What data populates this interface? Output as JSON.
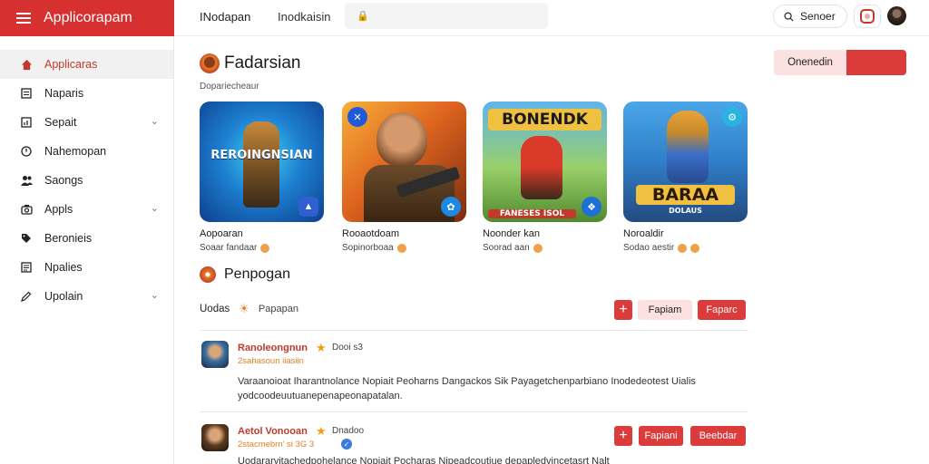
{
  "app": {
    "title": "Applicorapam"
  },
  "header": {
    "title": "INodapan",
    "subtitle": "Inodkaisin",
    "search_placeholder": "",
    "search_button": "Senoer"
  },
  "sidebar": {
    "items": [
      {
        "label": "Applicaras",
        "icon": "home-icon",
        "active": true,
        "chevron": false
      },
      {
        "label": "Naparis",
        "icon": "document-icon",
        "active": false,
        "chevron": false
      },
      {
        "label": "Sepait",
        "icon": "chart-icon",
        "active": false,
        "chevron": true
      },
      {
        "label": "Nahemopan",
        "icon": "clock-icon",
        "active": false,
        "chevron": false
      },
      {
        "label": "Saongs",
        "icon": "users-icon",
        "active": false,
        "chevron": false
      },
      {
        "label": "Appls",
        "icon": "camera-icon",
        "active": false,
        "chevron": true
      },
      {
        "label": "Beronieis",
        "icon": "tag-icon",
        "active": false,
        "chevron": false
      },
      {
        "label": "Npalies",
        "icon": "list-icon",
        "active": false,
        "chevron": false
      },
      {
        "label": "Upolain",
        "icon": "pen-icon",
        "active": false,
        "chevron": true
      }
    ]
  },
  "main": {
    "title": "Fadarsian",
    "subtitle": "Dopariecheaur",
    "primary_button": "Onenedin",
    "apps": [
      {
        "name": "Aopoaran",
        "meta": "Soaar fandaar",
        "art_label": "REROINGNSIAN"
      },
      {
        "name": "Rooaotdoam",
        "meta": "Sopinorboaa",
        "art_label": ""
      },
      {
        "name": "Noonder kan",
        "meta": "Soorad aan",
        "art_label": "BONENDK",
        "art_sub": "FANESES ISOL"
      },
      {
        "name": "Noroaldir",
        "meta": "Sodao aestir",
        "art_label": "BARAA",
        "art_sub": "DOLAUS"
      }
    ],
    "section2_title": "Penpogan",
    "filter_label": "Uodas",
    "filter_value": "Papapan",
    "action_light": "Fapiam",
    "action_red": "Faparc",
    "reviews": [
      {
        "name": "Ranoleongnun",
        "time": "Dooi s3",
        "meta": "2sahasoun iiasiin",
        "body": "Varaanoioat Iharantnolance Nopiait Peoharns Dangackos Sik Payagetchenparbiano Inodedeotest Uialis yodcoodeuutuanepenapeonapatalan."
      },
      {
        "name": "Aetol Vonooan",
        "time": "Dnadoo",
        "meta": "2stacmebrn’ si 3G 3",
        "body": "Uodararvitachedpohelance Nopiait Pocharas Nipeadcoutiue depapledvincetasrt Nalt",
        "btn_light": "Fapiani",
        "btn_red": "Beebdar"
      }
    ]
  }
}
